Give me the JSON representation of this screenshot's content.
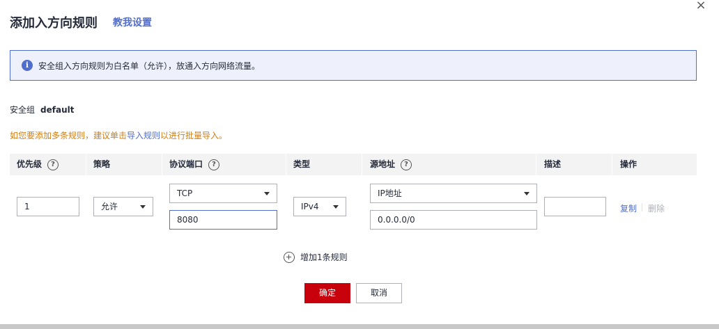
{
  "dialog": {
    "title": "添加入方向规则",
    "help_link": "教我设置",
    "close": "×"
  },
  "info": {
    "icon": "info-icon",
    "text": "安全组入方向规则为白名单（允许），放通入方向网络流量。"
  },
  "security_group": {
    "label": "安全组",
    "value": "default"
  },
  "tip": {
    "prefix": "如您要添加多条规则，建议单击",
    "link": "导入规则",
    "suffix": "以进行批量导入。"
  },
  "table": {
    "columns": [
      "优先级",
      "策略",
      "协议端口",
      "类型",
      "源地址",
      "描述",
      "操作"
    ]
  },
  "rule": {
    "priority": "1",
    "policy": "允许",
    "protocol": "TCP",
    "port": "8080",
    "ip_type": "IPv4",
    "source_type": "IP地址",
    "source_address": "0.0.0.0/0",
    "description": "",
    "copy": "复制",
    "delete": "删除"
  },
  "add_rule": "增加1条规则",
  "buttons": {
    "ok": "确定",
    "cancel": "取消"
  },
  "colors": {
    "primary": "#526ecc",
    "danger": "#c7000b",
    "warning": "#d27e13",
    "banner_bg": "#eef1fb"
  }
}
